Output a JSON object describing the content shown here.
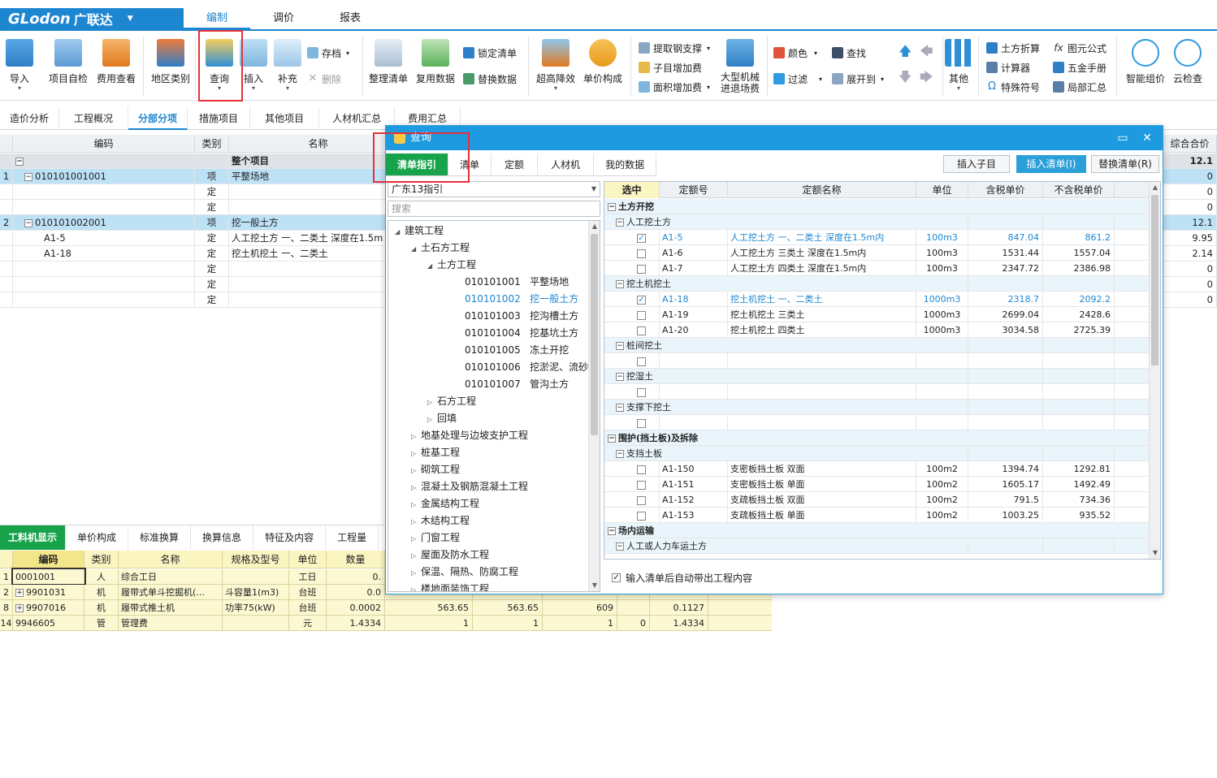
{
  "app": {
    "logo": "GLodon",
    "logo_cn": "广联达",
    "menu_tabs": [
      "编制",
      "调价",
      "报表"
    ]
  },
  "ribbon": {
    "import": "导入",
    "self_check": "项目自检",
    "fee_view": "费用查看",
    "region": "地区类别",
    "query": "查询",
    "insert": "插入",
    "supplement": "补充",
    "archive": "存档",
    "delete": "删除",
    "tidy": "整理清单",
    "reuse": "复用数据",
    "lock": "锁定清单",
    "replace": "替换数据",
    "height": "超高降效",
    "unit_comp": "单价构成",
    "rebar": "提取钢支撑",
    "sub_fee": "子目增加费",
    "area_fee": "面积增加费",
    "machine": "大型机械",
    "machine2": "进退场费",
    "color": "颜色",
    "find": "查找",
    "filter": "过滤",
    "expand": "展开到",
    "other": "其他",
    "earth": "土方折算",
    "calc": "计算器",
    "symbol": "特殊符号",
    "formula": "图元公式",
    "hardware": "五金手册",
    "local_sum": "局部汇总",
    "smart": "智能组价",
    "cloud": "云检查"
  },
  "subtabs": [
    "造价分析",
    "工程概况",
    "分部分项",
    "措施项目",
    "其他项目",
    "人材机汇总",
    "费用汇总"
  ],
  "grid": {
    "headers": [
      "编码",
      "类别",
      "名称",
      "综合合价"
    ],
    "summary": {
      "name": "整个项目",
      "total": "12.1"
    },
    "rows": [
      {
        "no": "1",
        "code": "010101001001",
        "type": "项",
        "name": "平整场地",
        "total": "0",
        "sel": true
      },
      {
        "no": "",
        "code": "",
        "type": "定",
        "name": "",
        "total": "0"
      },
      {
        "no": "",
        "code": "",
        "type": "定",
        "name": "",
        "total": "0"
      },
      {
        "no": "2",
        "code": "010101002001",
        "type": "项",
        "name": "挖一般土方",
        "total": "12.1",
        "sel": true
      },
      {
        "no": "",
        "code": "A1-5",
        "type": "定",
        "name": "人工挖土方 一、二类土 深度在1.5m",
        "total": "9.95"
      },
      {
        "no": "",
        "code": "A1-18",
        "type": "定",
        "name": "挖土机挖土 一、二类土",
        "total": "2.14"
      },
      {
        "no": "",
        "code": "",
        "type": "定",
        "name": "",
        "total": "0"
      },
      {
        "no": "",
        "code": "",
        "type": "定",
        "name": "",
        "total": "0"
      },
      {
        "no": "",
        "code": "",
        "type": "定",
        "name": "",
        "total": "0"
      }
    ]
  },
  "bottom": {
    "tabs": [
      "工料机显示",
      "单价构成",
      "标准换算",
      "换算信息",
      "特征及内容",
      "工程量"
    ],
    "headers": [
      "编码",
      "类别",
      "名称",
      "规格及型号",
      "单位",
      "数量"
    ],
    "rows": [
      {
        "no": "1",
        "code": "0001001",
        "type": "人",
        "name": "综合工日",
        "spec": "",
        "unit": "工日",
        "qty": "0.",
        "c1": "",
        "c2": "",
        "c3": "",
        "c4": "",
        "c5": ""
      },
      {
        "no": "2",
        "code": "9901031",
        "type": "机",
        "name": "履带式单斗挖掘机(…",
        "spec": "斗容量1(m3)",
        "unit": "台班",
        "qty": "0.0",
        "c1": "",
        "c2": "",
        "c3": "",
        "c4": "",
        "c5": "",
        "exp": true
      },
      {
        "no": "8",
        "code": "9907016",
        "type": "机",
        "name": "履带式推土机",
        "spec": "功率75(kW)",
        "unit": "台班",
        "qty": "0.0002",
        "c1": "563.65",
        "c2": "563.65",
        "c3": "609",
        "c4": "",
        "c5": "0.1127",
        "exp": true
      },
      {
        "no": "14",
        "code": "9946605",
        "type": "管",
        "name": "管理费",
        "spec": "",
        "unit": "元",
        "qty": "1.4334",
        "c1": "1",
        "c2": "1",
        "c3": "1",
        "c4": "0",
        "c5": "1.4334"
      }
    ]
  },
  "dialog": {
    "title": "查询",
    "tabs": [
      "清单指引",
      "清单",
      "定额",
      "人材机",
      "我的数据"
    ],
    "btn_insert_sub": "插入子目",
    "btn_insert_list": "插入清单(I)",
    "btn_replace_list": "替换清单(R)",
    "combo": "广东13指引",
    "search_placeholder": "搜索",
    "tree": [
      {
        "label": "建筑工程",
        "lvl": 0,
        "tri": "◢"
      },
      {
        "label": "土石方工程",
        "lvl": 1,
        "tri": "◢"
      },
      {
        "label": "土方工程",
        "lvl": 2,
        "tri": "◢"
      },
      {
        "label": "010101001   平整场地",
        "lvl": 3,
        "tri": ""
      },
      {
        "label": "010101002   挖一般土方",
        "lvl": 3,
        "tri": "",
        "blue": true
      },
      {
        "label": "010101003   挖沟槽土方",
        "lvl": 3,
        "tri": ""
      },
      {
        "label": "010101004   挖基坑土方",
        "lvl": 3,
        "tri": ""
      },
      {
        "label": "010101005   冻土开挖",
        "lvl": 3,
        "tri": ""
      },
      {
        "label": "010101006   挖淤泥、流砂",
        "lvl": 3,
        "tri": ""
      },
      {
        "label": "010101007   管沟土方",
        "lvl": 3,
        "tri": ""
      },
      {
        "label": "石方工程",
        "lvl": 2,
        "tri": "▷"
      },
      {
        "label": "回填",
        "lvl": 2,
        "tri": "▷"
      },
      {
        "label": "地基处理与边坡支护工程",
        "lvl": 1,
        "tri": "▷"
      },
      {
        "label": "桩基工程",
        "lvl": 1,
        "tri": "▷"
      },
      {
        "label": "砌筑工程",
        "lvl": 1,
        "tri": "▷"
      },
      {
        "label": "混凝土及钢筋混凝土工程",
        "lvl": 1,
        "tri": "▷"
      },
      {
        "label": "金属结构工程",
        "lvl": 1,
        "tri": "▷"
      },
      {
        "label": "木结构工程",
        "lvl": 1,
        "tri": "▷"
      },
      {
        "label": "门窗工程",
        "lvl": 1,
        "tri": "▷"
      },
      {
        "label": "屋面及防水工程",
        "lvl": 1,
        "tri": "▷"
      },
      {
        "label": "保温、隔热、防腐工程",
        "lvl": 1,
        "tri": "▷"
      },
      {
        "label": "楼地面装饰工程",
        "lvl": 1,
        "tri": "▷"
      }
    ],
    "table_headers": [
      "选中",
      "定额号",
      "定额名称",
      "单位",
      "含税单价",
      "不含税单价"
    ],
    "table_rows": [
      {
        "kind": "g1",
        "label": "土方开挖"
      },
      {
        "kind": "g2",
        "label": "人工挖土方"
      },
      {
        "kind": "item",
        "checked": true,
        "blue": true,
        "code": "A1-5",
        "name": "人工挖土方 一、二类土 深度在1.5m内",
        "unit": "100m3",
        "p1": "847.04",
        "p2": "861.2"
      },
      {
        "kind": "item",
        "code": "A1-6",
        "name": "人工挖土方 三类土 深度在1.5m内",
        "unit": "100m3",
        "p1": "1531.44",
        "p2": "1557.04"
      },
      {
        "kind": "item",
        "code": "A1-7",
        "name": "人工挖土方 四类土 深度在1.5m内",
        "unit": "100m3",
        "p1": "2347.72",
        "p2": "2386.98"
      },
      {
        "kind": "g2",
        "label": "挖土机挖土"
      },
      {
        "kind": "item",
        "checked": true,
        "blue": true,
        "code": "A1-18",
        "name": "挖土机挖土 一、二类土",
        "unit": "1000m3",
        "p1": "2318.7",
        "p2": "2092.2"
      },
      {
        "kind": "item",
        "code": "A1-19",
        "name": "挖土机挖土 三类土",
        "unit": "1000m3",
        "p1": "2699.04",
        "p2": "2428.6"
      },
      {
        "kind": "item",
        "code": "A1-20",
        "name": "挖土机挖土 四类土",
        "unit": "1000m3",
        "p1": "3034.58",
        "p2": "2725.39"
      },
      {
        "kind": "g2",
        "label": "桩间挖土"
      },
      {
        "kind": "item",
        "code": "",
        "name": "",
        "unit": "",
        "p1": "",
        "p2": ""
      },
      {
        "kind": "g2",
        "label": "挖湿土"
      },
      {
        "kind": "item",
        "code": "",
        "name": "",
        "unit": "",
        "p1": "",
        "p2": ""
      },
      {
        "kind": "g2",
        "label": "支撑下挖土"
      },
      {
        "kind": "item",
        "code": "",
        "name": "",
        "unit": "",
        "p1": "",
        "p2": ""
      },
      {
        "kind": "g1",
        "label": "围护(挡土板)及拆除"
      },
      {
        "kind": "g2",
        "label": "支挡土板"
      },
      {
        "kind": "item",
        "code": "A1-150",
        "name": "支密板挡土板 双面",
        "unit": "100m2",
        "p1": "1394.74",
        "p2": "1292.81"
      },
      {
        "kind": "item",
        "code": "A1-151",
        "name": "支密板挡土板 单面",
        "unit": "100m2",
        "p1": "1605.17",
        "p2": "1492.49"
      },
      {
        "kind": "item",
        "code": "A1-152",
        "name": "支疏板挡土板 双面",
        "unit": "100m2",
        "p1": "791.5",
        "p2": "734.36"
      },
      {
        "kind": "item",
        "code": "A1-153",
        "name": "支疏板挡土板 单面",
        "unit": "100m2",
        "p1": "1003.25",
        "p2": "935.52"
      },
      {
        "kind": "g1",
        "label": "场内运输"
      },
      {
        "kind": "g2",
        "label": "人工或人力车运土方"
      }
    ],
    "footer_check": "输入清单后自动带出工程内容"
  }
}
